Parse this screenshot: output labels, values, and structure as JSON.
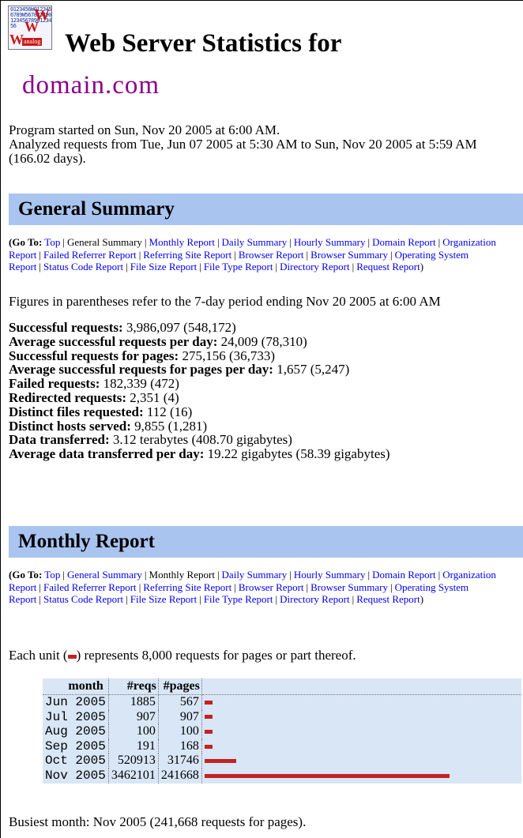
{
  "header": {
    "logo_icon": "analog-logo-icon",
    "logo_digits": "0123456W0123456789W5678234901234567890123456",
    "logo_letter": "W",
    "logo_text": "analog",
    "title_line1": "Web Server Statistics for",
    "title_line2": "domain.com"
  },
  "intro": {
    "program_started": "Program started on Sun, Nov 20 2005 at 6:00 AM.",
    "analyzed": "Analyzed requests from Tue, Jun 07 2005 at 5:30 AM to Sun, Nov 20 2005 at 5:59 AM (166.02 days)."
  },
  "general_summary": {
    "heading": "General Summary",
    "goto_label": "(Go To",
    "goto_colon": ":",
    "goto_close": ")",
    "links": {
      "top": "Top",
      "general_summary": "General Summary",
      "monthly_report": "Monthly Report",
      "daily_summary": "Daily Summary",
      "hourly_summary": "Hourly Summary",
      "domain_report": "Domain Report",
      "organization_report": "Organization Report",
      "failed_referrer_report": "Failed Referrer Report",
      "referring_site_report": "Referring Site Report",
      "browser_report": "Browser Report",
      "browser_summary": "Browser Summary",
      "operating_system_report": "Operating System Report",
      "status_code_report": "Status Code Report",
      "file_size_report": "File Size Report",
      "file_type_report": "File Type Report",
      "directory_report": "Directory Report",
      "request_report": "Request Report"
    },
    "figures_note": "Figures in parentheses refer to the 7-day period ending Nov 20 2005 at 6:00 AM",
    "rows": [
      {
        "label": "Successful requests:",
        "value": "3,986,097 (548,172)"
      },
      {
        "label": "Average successful requests per day:",
        "value": "24,009 (78,310)"
      },
      {
        "label": "Successful requests for pages:",
        "value": "275,156 (36,733)"
      },
      {
        "label": "Average successful requests for pages per day:",
        "value": "1,657 (5,247)"
      },
      {
        "label": "Failed requests:",
        "value": "182,339 (472)"
      },
      {
        "label": "Redirected requests:",
        "value": "2,351 (4)"
      },
      {
        "label": "Distinct files requested:",
        "value": "112 (16)"
      },
      {
        "label": "Distinct hosts served:",
        "value": "9,855 (1,281)"
      },
      {
        "label": "Data transferred:",
        "value": "3.12 terabytes (408.70 gigabytes)"
      },
      {
        "label": "Average data transferred per day:",
        "value": "19.22 gigabytes (58.39 gigabytes)"
      }
    ]
  },
  "monthly_report": {
    "heading": "Monthly Report",
    "unit_note_before": "Each unit (",
    "unit_note_after": ") represents 8,000 requests for pages or part thereof.",
    "bar_color": "#c42222",
    "table_bg": "#d8e6f6",
    "columns": {
      "month": "month",
      "reqs": "#reqs",
      "pages": "#pages"
    },
    "rows": [
      {
        "month": "Jun 2005",
        "reqs": "1885",
        "pages": "567",
        "units": 1
      },
      {
        "month": "Jul 2005",
        "reqs": "907",
        "pages": "907",
        "units": 1
      },
      {
        "month": "Aug 2005",
        "reqs": "100",
        "pages": "100",
        "units": 1
      },
      {
        "month": "Sep 2005",
        "reqs": "191",
        "pages": "168",
        "units": 1
      },
      {
        "month": "Oct 2005",
        "reqs": "520913",
        "pages": "31746",
        "units": 4
      },
      {
        "month": "Nov 2005",
        "reqs": "3462101",
        "pages": "241668",
        "units": 31
      }
    ],
    "busiest": "Busiest month: Nov 2005 (241,668 requests for pages)."
  },
  "colors": {
    "section_bar": "#a9c4ef",
    "link": "#0000ee",
    "domain_title": "#880088"
  }
}
